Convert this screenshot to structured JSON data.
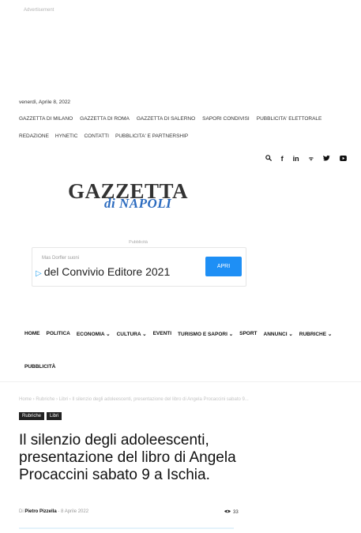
{
  "ad_top_label": "Advertisement",
  "date": "venerdì, Aprile 8, 2022",
  "top_links_1": [
    "GAZZETTA DI MILANO",
    "GAZZETTA DI ROMA",
    "GAZZETTA DI SALERNO",
    "SAPORI CONDIVISI",
    "PUBBLICITA' ELETTORALE"
  ],
  "top_links_2": [
    "REDAZIONE",
    "HYNETIC",
    "CONTATTI",
    "PUBBLICITA' E PARTNERSHIP"
  ],
  "social_icons": [
    "search-icon",
    "facebook-icon",
    "linkedin-icon",
    "rss-icon",
    "twitter-icon",
    "youtube-icon"
  ],
  "logo": {
    "main": "GAZZETTA",
    "sub": "di NAPOLI"
  },
  "ad": {
    "label": "Pubblicità",
    "small": "Mas Dorfler suoni",
    "title": "del Convivio Editore 2021",
    "button": "APRI",
    "accent": "#1e8ff5"
  },
  "main_nav": [
    "HOME",
    "POLITICA",
    "ECONOMIA ⌄",
    "CULTURA ⌄",
    "EVENTI",
    "TURISMO E SAPORI ⌄",
    "SPORT",
    "ANNUNCI ⌄",
    "RUBRICHE ⌄"
  ],
  "main_nav_2": "PUBBLICITÀ",
  "breadcrumb": "Home  ›  Rubriche  ›  Libri  ›  Il silenzio degli adoleescenti, presentazione del libro di Angela Procaccini sabato 9...",
  "categories": [
    "Rubriche",
    "Libri"
  ],
  "headline": "Il silenzio degli adoleescenti, presentazione del libro di Angela Procaccini sabato 9 a Ischia.",
  "byline": {
    "prefix": "Di",
    "author": "Pietro Pizzella",
    "date": "-  8 Aprile 2022"
  },
  "views": "33"
}
